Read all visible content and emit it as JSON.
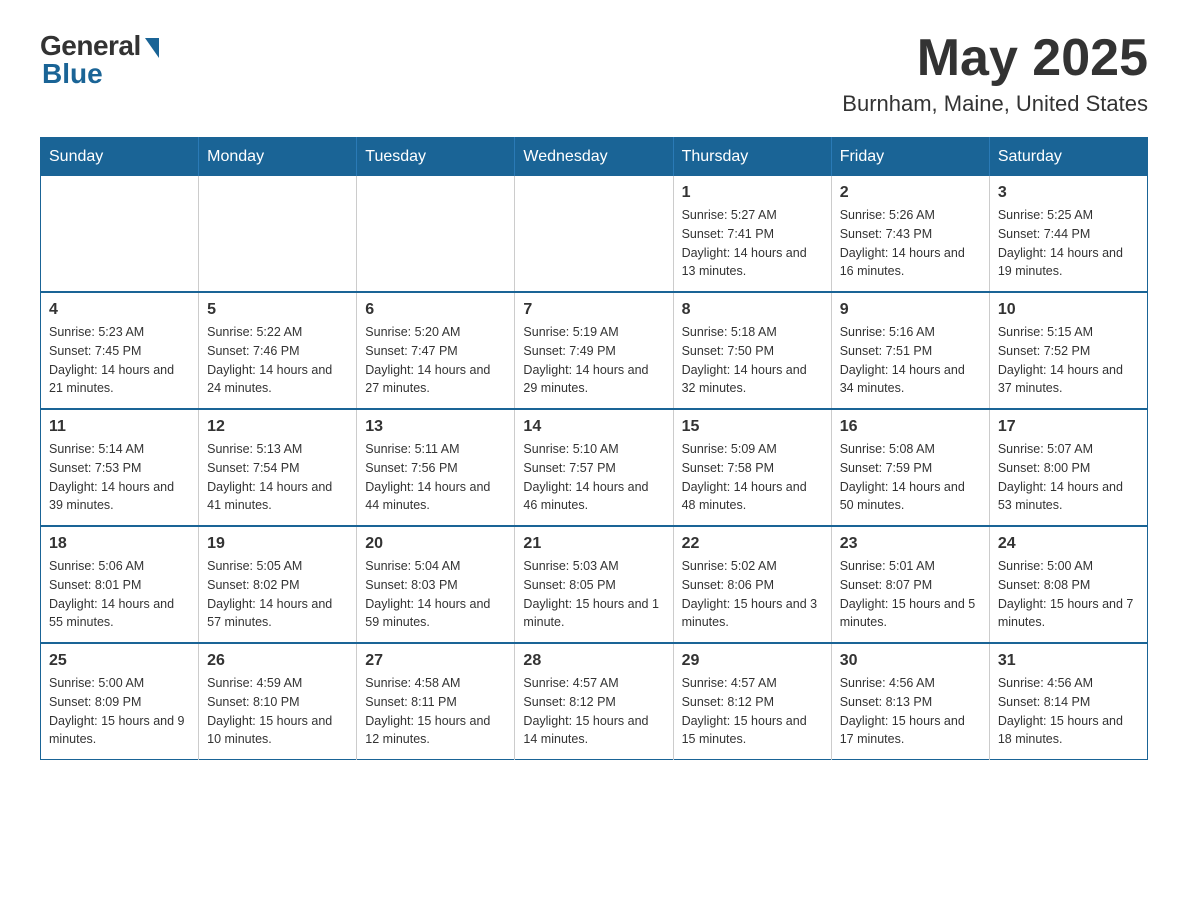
{
  "header": {
    "logo_general": "General",
    "logo_blue": "Blue",
    "month_title": "May 2025",
    "location": "Burnham, Maine, United States"
  },
  "calendar": {
    "days_of_week": [
      "Sunday",
      "Monday",
      "Tuesday",
      "Wednesday",
      "Thursday",
      "Friday",
      "Saturday"
    ],
    "weeks": [
      [
        {
          "day": "",
          "info": ""
        },
        {
          "day": "",
          "info": ""
        },
        {
          "day": "",
          "info": ""
        },
        {
          "day": "",
          "info": ""
        },
        {
          "day": "1",
          "info": "Sunrise: 5:27 AM\nSunset: 7:41 PM\nDaylight: 14 hours and 13 minutes."
        },
        {
          "day": "2",
          "info": "Sunrise: 5:26 AM\nSunset: 7:43 PM\nDaylight: 14 hours and 16 minutes."
        },
        {
          "day": "3",
          "info": "Sunrise: 5:25 AM\nSunset: 7:44 PM\nDaylight: 14 hours and 19 minutes."
        }
      ],
      [
        {
          "day": "4",
          "info": "Sunrise: 5:23 AM\nSunset: 7:45 PM\nDaylight: 14 hours and 21 minutes."
        },
        {
          "day": "5",
          "info": "Sunrise: 5:22 AM\nSunset: 7:46 PM\nDaylight: 14 hours and 24 minutes."
        },
        {
          "day": "6",
          "info": "Sunrise: 5:20 AM\nSunset: 7:47 PM\nDaylight: 14 hours and 27 minutes."
        },
        {
          "day": "7",
          "info": "Sunrise: 5:19 AM\nSunset: 7:49 PM\nDaylight: 14 hours and 29 minutes."
        },
        {
          "day": "8",
          "info": "Sunrise: 5:18 AM\nSunset: 7:50 PM\nDaylight: 14 hours and 32 minutes."
        },
        {
          "day": "9",
          "info": "Sunrise: 5:16 AM\nSunset: 7:51 PM\nDaylight: 14 hours and 34 minutes."
        },
        {
          "day": "10",
          "info": "Sunrise: 5:15 AM\nSunset: 7:52 PM\nDaylight: 14 hours and 37 minutes."
        }
      ],
      [
        {
          "day": "11",
          "info": "Sunrise: 5:14 AM\nSunset: 7:53 PM\nDaylight: 14 hours and 39 minutes."
        },
        {
          "day": "12",
          "info": "Sunrise: 5:13 AM\nSunset: 7:54 PM\nDaylight: 14 hours and 41 minutes."
        },
        {
          "day": "13",
          "info": "Sunrise: 5:11 AM\nSunset: 7:56 PM\nDaylight: 14 hours and 44 minutes."
        },
        {
          "day": "14",
          "info": "Sunrise: 5:10 AM\nSunset: 7:57 PM\nDaylight: 14 hours and 46 minutes."
        },
        {
          "day": "15",
          "info": "Sunrise: 5:09 AM\nSunset: 7:58 PM\nDaylight: 14 hours and 48 minutes."
        },
        {
          "day": "16",
          "info": "Sunrise: 5:08 AM\nSunset: 7:59 PM\nDaylight: 14 hours and 50 minutes."
        },
        {
          "day": "17",
          "info": "Sunrise: 5:07 AM\nSunset: 8:00 PM\nDaylight: 14 hours and 53 minutes."
        }
      ],
      [
        {
          "day": "18",
          "info": "Sunrise: 5:06 AM\nSunset: 8:01 PM\nDaylight: 14 hours and 55 minutes."
        },
        {
          "day": "19",
          "info": "Sunrise: 5:05 AM\nSunset: 8:02 PM\nDaylight: 14 hours and 57 minutes."
        },
        {
          "day": "20",
          "info": "Sunrise: 5:04 AM\nSunset: 8:03 PM\nDaylight: 14 hours and 59 minutes."
        },
        {
          "day": "21",
          "info": "Sunrise: 5:03 AM\nSunset: 8:05 PM\nDaylight: 15 hours and 1 minute."
        },
        {
          "day": "22",
          "info": "Sunrise: 5:02 AM\nSunset: 8:06 PM\nDaylight: 15 hours and 3 minutes."
        },
        {
          "day": "23",
          "info": "Sunrise: 5:01 AM\nSunset: 8:07 PM\nDaylight: 15 hours and 5 minutes."
        },
        {
          "day": "24",
          "info": "Sunrise: 5:00 AM\nSunset: 8:08 PM\nDaylight: 15 hours and 7 minutes."
        }
      ],
      [
        {
          "day": "25",
          "info": "Sunrise: 5:00 AM\nSunset: 8:09 PM\nDaylight: 15 hours and 9 minutes."
        },
        {
          "day": "26",
          "info": "Sunrise: 4:59 AM\nSunset: 8:10 PM\nDaylight: 15 hours and 10 minutes."
        },
        {
          "day": "27",
          "info": "Sunrise: 4:58 AM\nSunset: 8:11 PM\nDaylight: 15 hours and 12 minutes."
        },
        {
          "day": "28",
          "info": "Sunrise: 4:57 AM\nSunset: 8:12 PM\nDaylight: 15 hours and 14 minutes."
        },
        {
          "day": "29",
          "info": "Sunrise: 4:57 AM\nSunset: 8:12 PM\nDaylight: 15 hours and 15 minutes."
        },
        {
          "day": "30",
          "info": "Sunrise: 4:56 AM\nSunset: 8:13 PM\nDaylight: 15 hours and 17 minutes."
        },
        {
          "day": "31",
          "info": "Sunrise: 4:56 AM\nSunset: 8:14 PM\nDaylight: 15 hours and 18 minutes."
        }
      ]
    ]
  }
}
